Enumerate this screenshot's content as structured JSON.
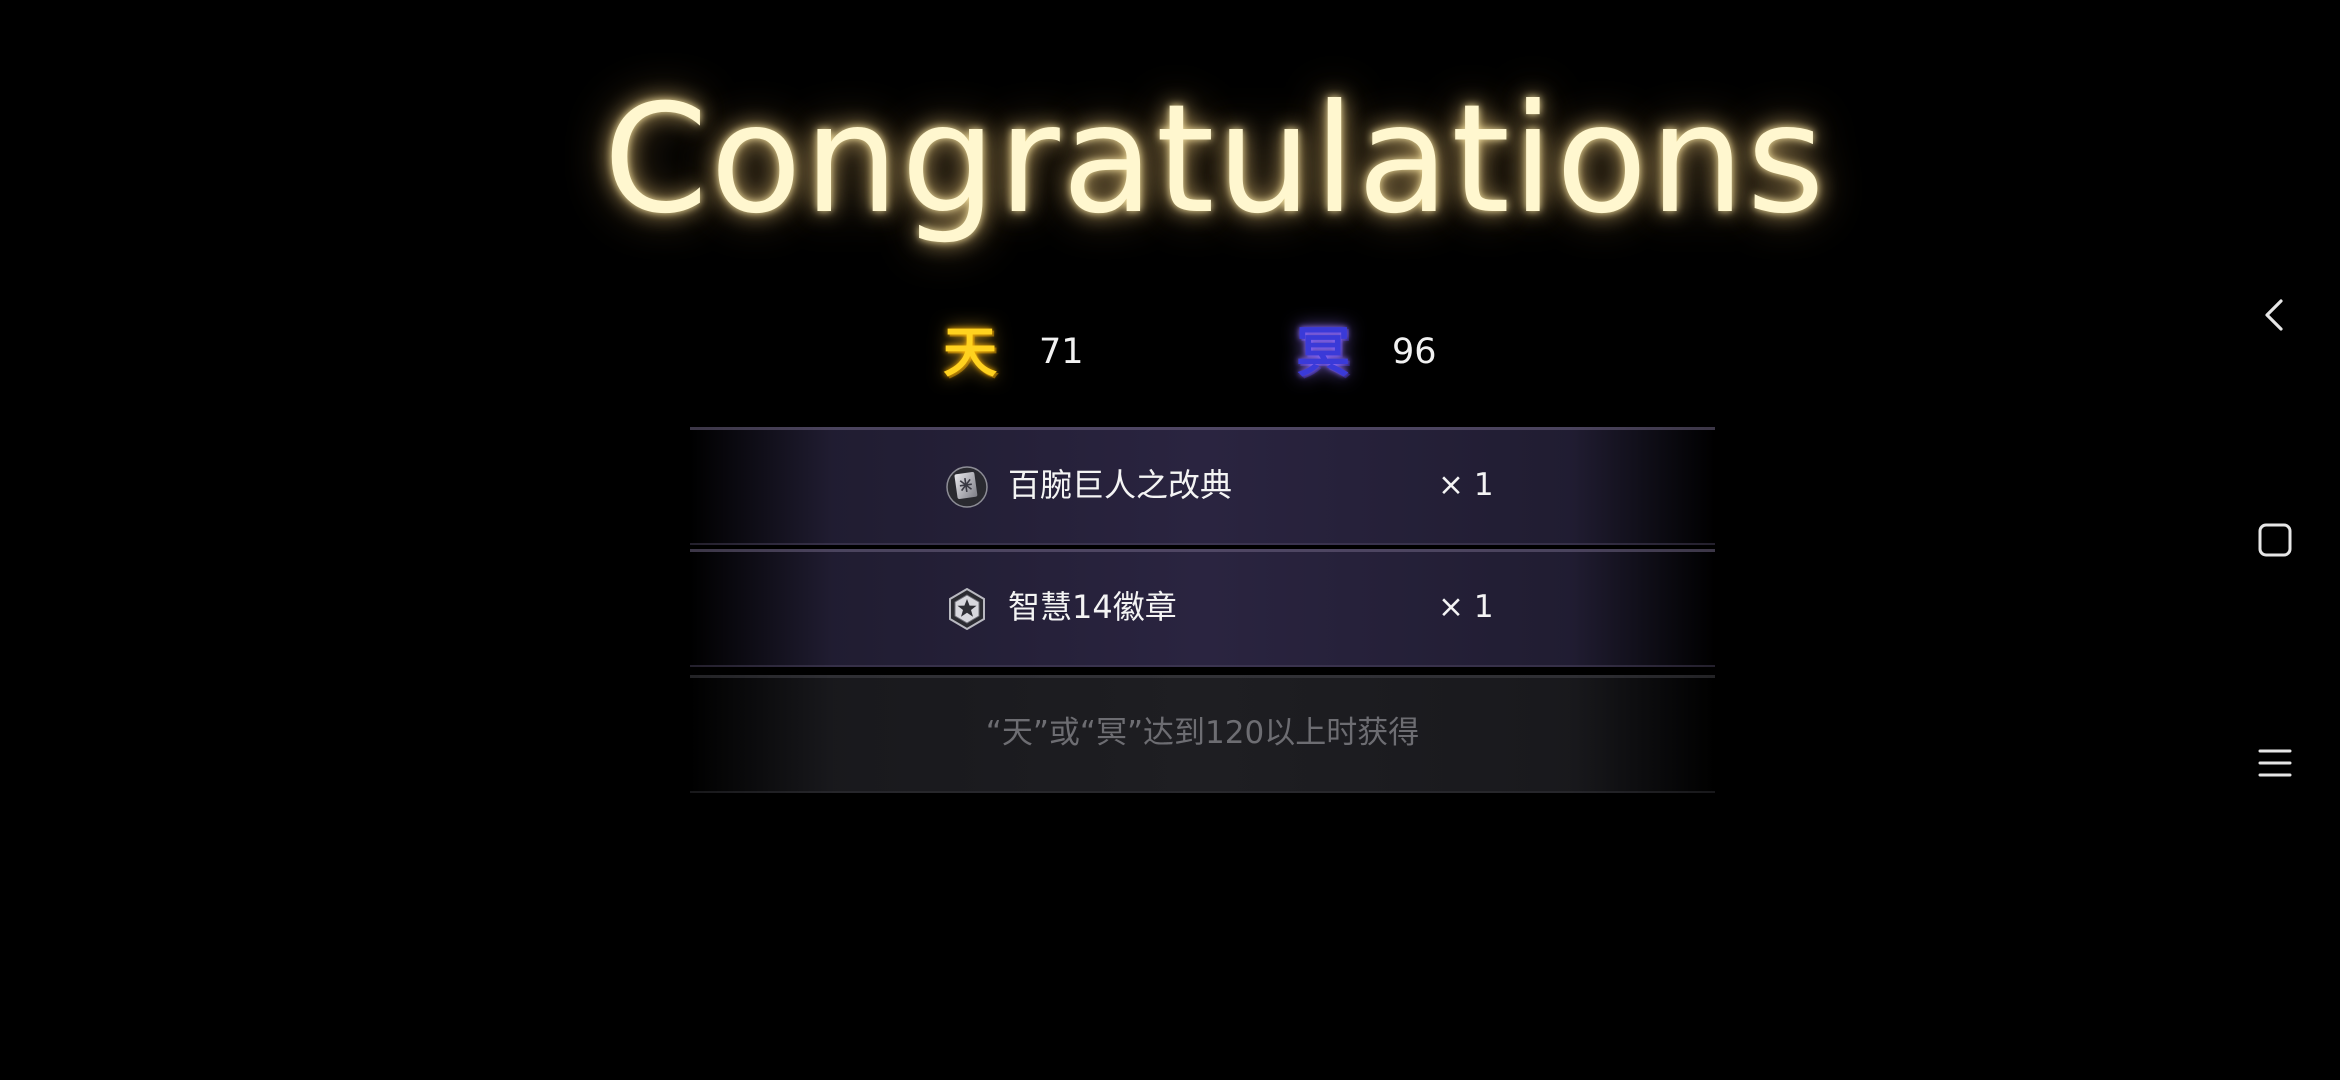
{
  "title": "Congratulations",
  "scores": [
    {
      "glyph": "天",
      "value": "71",
      "color": "#ffd21f"
    },
    {
      "glyph": "冥",
      "value": "96",
      "color": "#3a3ad8"
    }
  ],
  "rewards": [
    {
      "name": "百腕巨人之改典",
      "quantity": "× 1",
      "icon": "rune-tablet-icon"
    },
    {
      "name": "智慧14徽章",
      "quantity": "× 1",
      "icon": "star-badge-icon"
    }
  ],
  "hint": "“天”或“冥”达到120以上时获得",
  "system_nav": {
    "back": "back-icon",
    "home": "home-icon",
    "menu": "menu-icon"
  }
}
